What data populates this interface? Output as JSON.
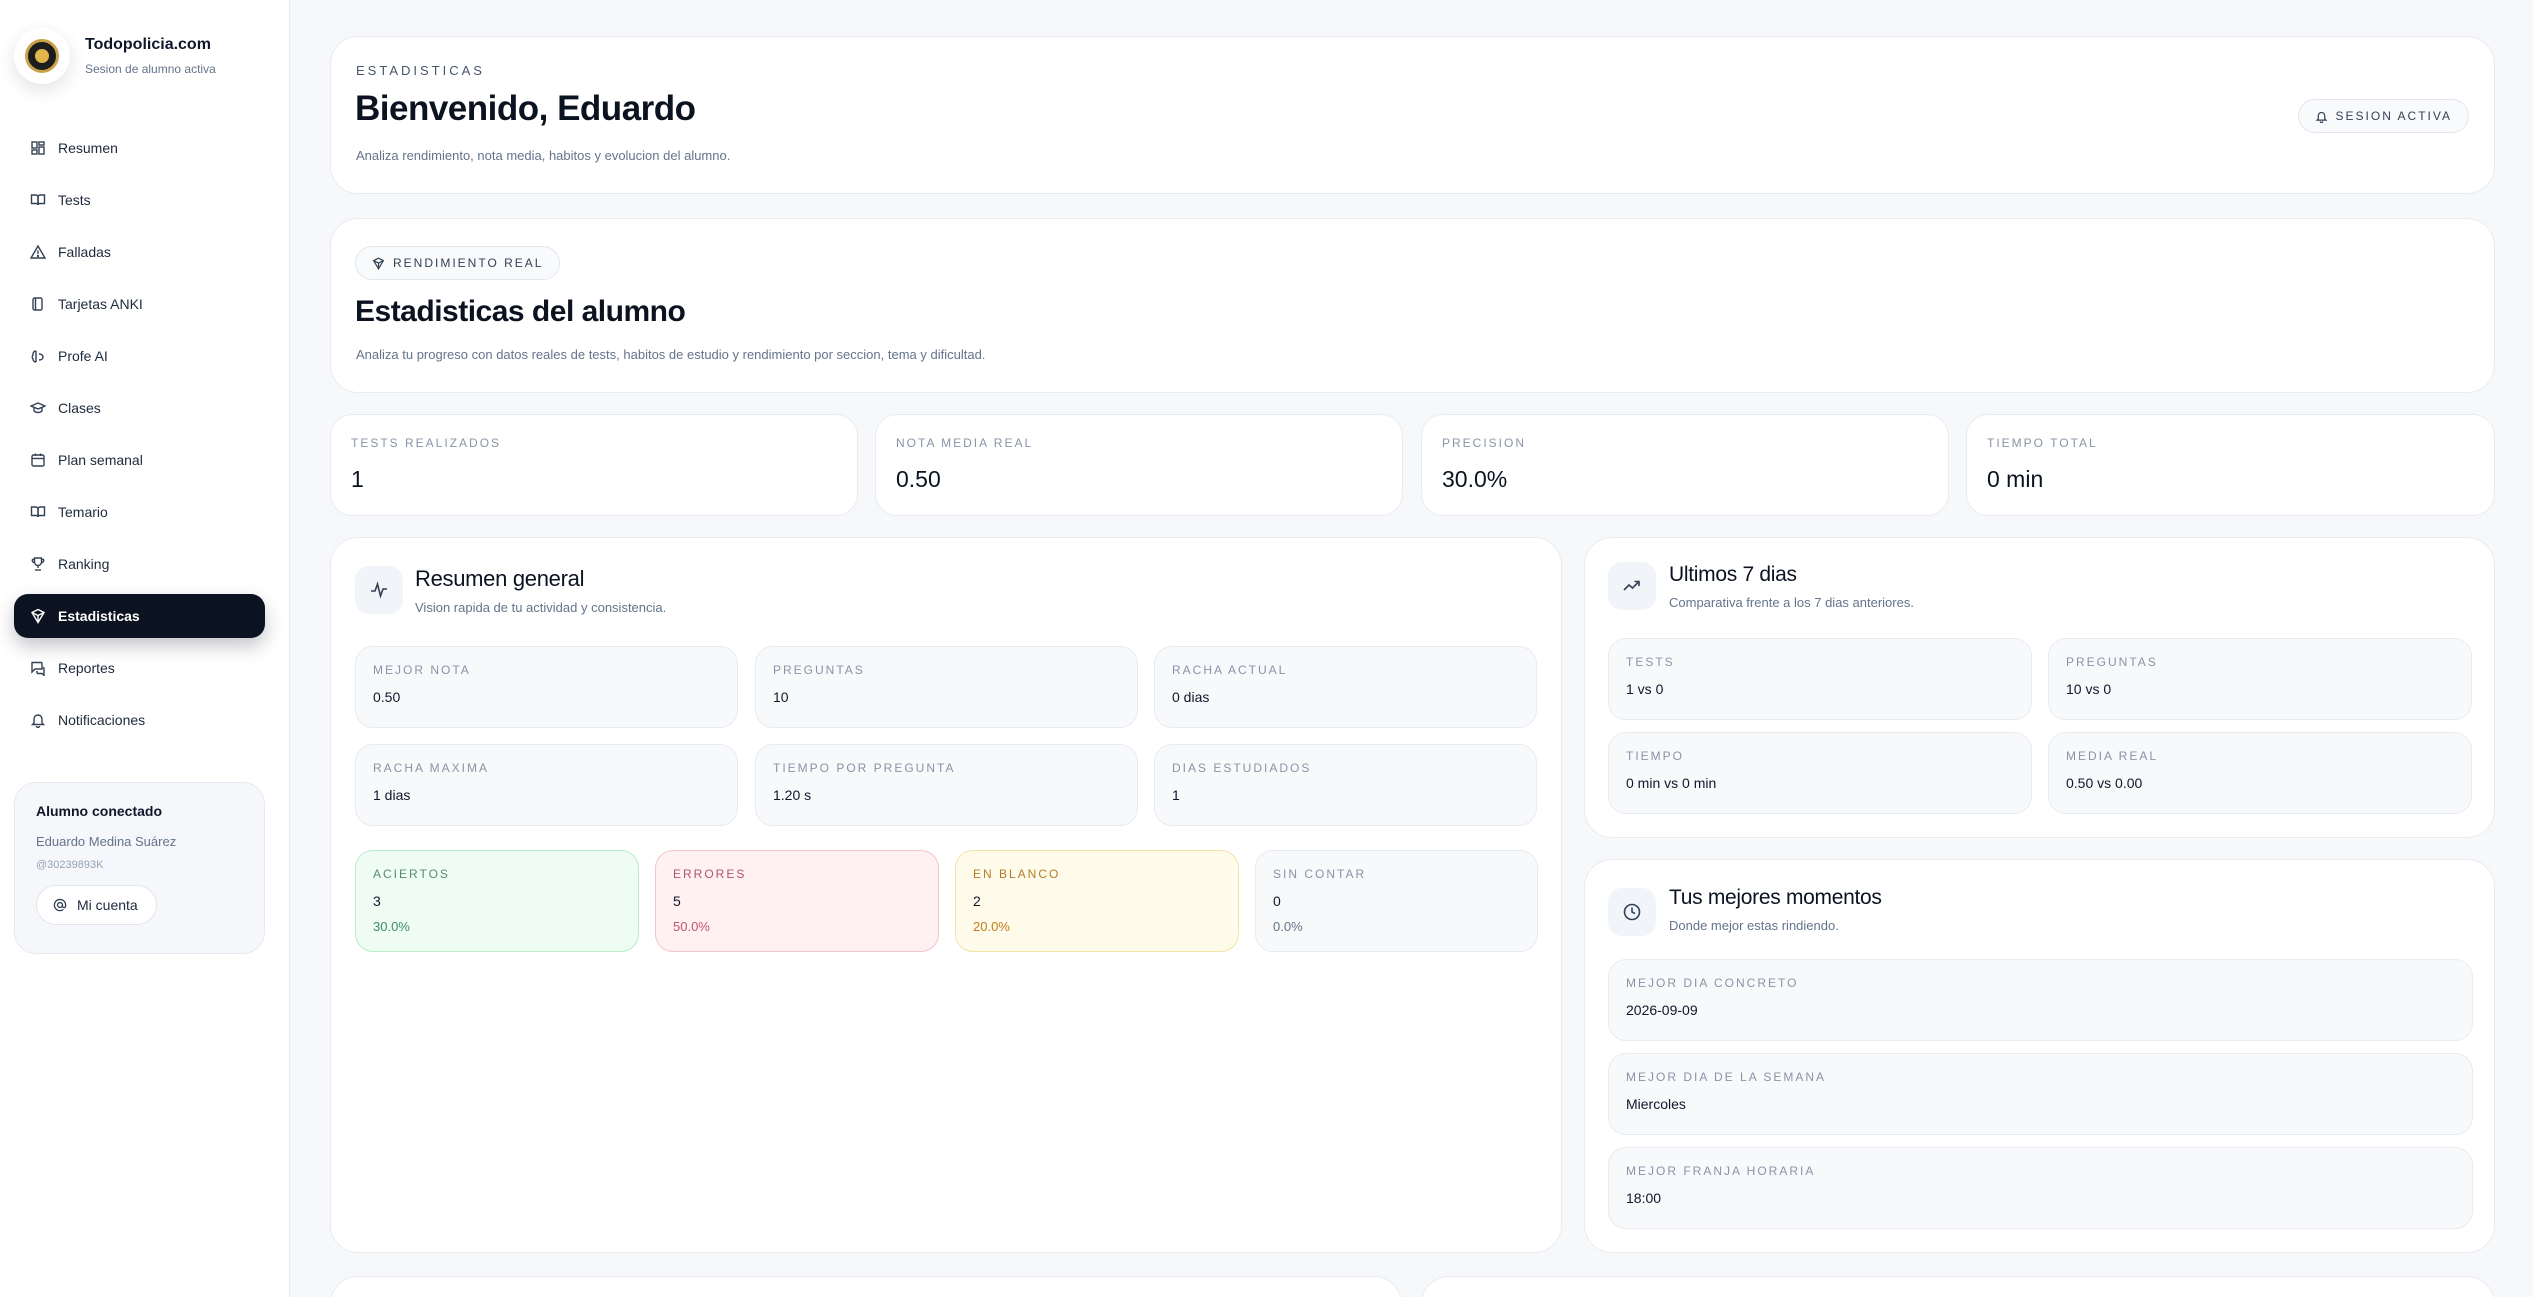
{
  "brand": {
    "name": "Todopolicia.com",
    "subtitle": "Sesion de alumno activa"
  },
  "nav": [
    {
      "label": "Resumen",
      "icon": "dashboard-icon"
    },
    {
      "label": "Tests",
      "icon": "book-open-icon"
    },
    {
      "label": "Falladas",
      "icon": "warning-icon"
    },
    {
      "label": "Tarjetas ANKI",
      "icon": "cards-icon"
    },
    {
      "label": "Profe AI",
      "icon": "ai-icon"
    },
    {
      "label": "Clases",
      "icon": "graduation-cap-icon"
    },
    {
      "label": "Plan semanal",
      "icon": "calendar-icon"
    },
    {
      "label": "Temario",
      "icon": "book-icon"
    },
    {
      "label": "Ranking",
      "icon": "trophy-icon"
    },
    {
      "label": "Estadisticas",
      "icon": "stats-icon",
      "active": true
    },
    {
      "label": "Reportes",
      "icon": "report-icon"
    },
    {
      "label": "Notificaciones",
      "icon": "bell-icon"
    }
  ],
  "user": {
    "title": "Alumno conectado",
    "name": "Eduardo Medina Suárez",
    "id": "@30239893K",
    "account_button": "Mi cuenta"
  },
  "header": {
    "eyebrow": "ESTADISTICAS",
    "title": "Bienvenido, Eduardo",
    "description": "Analiza rendimiento, nota media, habitos y evolucion del alumno.",
    "session_badge": "SESION ACTIVA"
  },
  "hero": {
    "badge": "RENDIMIENTO REAL",
    "title": "Estadisticas del alumno",
    "description": "Analiza tu progreso con datos reales de tests, habitos de estudio y rendimiento por seccion, tema y dificultad."
  },
  "stats": [
    {
      "label": "TESTS REALIZADOS",
      "value": "1"
    },
    {
      "label": "NOTA MEDIA REAL",
      "value": "0.50"
    },
    {
      "label": "PRECISION",
      "value": "30.0%"
    },
    {
      "label": "TIEMPO TOTAL",
      "value": "0 min"
    }
  ],
  "summary": {
    "title": "Resumen general",
    "subtitle": "Vision rapida de tu actividad y consistencia.",
    "items": [
      {
        "label": "MEJOR NOTA",
        "value": "0.50"
      },
      {
        "label": "PREGUNTAS",
        "value": "10"
      },
      {
        "label": "RACHA ACTUAL",
        "value": "0 dias"
      },
      {
        "label": "RACHA MAXIMA",
        "value": "1 dias"
      },
      {
        "label": "TIEMPO POR PREGUNTA",
        "value": "1.20 s"
      },
      {
        "label": "DIAS ESTUDIADOS",
        "value": "1"
      }
    ],
    "results": [
      {
        "label": "ACIERTOS",
        "value": "3",
        "pct": "30.0%"
      },
      {
        "label": "ERRORES",
        "value": "5",
        "pct": "50.0%"
      },
      {
        "label": "EN BLANCO",
        "value": "2",
        "pct": "20.0%"
      },
      {
        "label": "SIN CONTAR",
        "value": "0",
        "pct": "0.0%"
      }
    ]
  },
  "last7": {
    "title": "Ultimos 7 dias",
    "subtitle": "Comparativa frente a los 7 dias anteriores.",
    "items": [
      {
        "label": "TESTS",
        "value": "1 vs 0"
      },
      {
        "label": "PREGUNTAS",
        "value": "10 vs 0"
      },
      {
        "label": "TIEMPO",
        "value": "0 min vs 0 min"
      },
      {
        "label": "MEDIA REAL",
        "value": "0.50 vs 0.00"
      }
    ]
  },
  "best": {
    "title": "Tus mejores momentos",
    "subtitle": "Donde mejor estas rindiendo.",
    "items": [
      {
        "label": "MEJOR DIA CONCRETO",
        "value": "2026-09-09"
      },
      {
        "label": "MEJOR DIA DE LA SEMANA",
        "value": "Miercoles"
      },
      {
        "label": "MEJOR FRANJA HORARIA",
        "value": "18:00"
      }
    ]
  }
}
